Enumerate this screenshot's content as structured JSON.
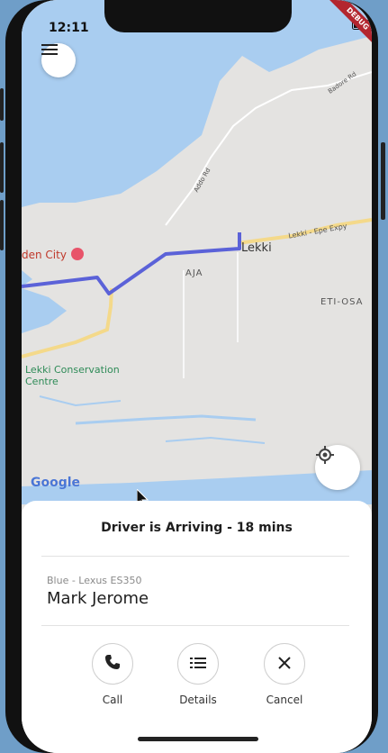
{
  "status_bar": {
    "time": "12:11",
    "debug_label": "DEBUG"
  },
  "map": {
    "labels": {
      "city": "den City",
      "lekki": "Lekki",
      "aja": "AJA",
      "eti_osa": "ETI-OSA",
      "conservation": "Lekki Conservation Centre",
      "expressway": "Lekki - Epe Expy",
      "road_addo": "Addo Rd",
      "road_badore": "Badore Rd"
    },
    "attribution": "Google",
    "route_color": "#5b62d8"
  },
  "controls": {
    "menu_icon": "menu-icon",
    "locate_icon": "my-location-icon"
  },
  "sheet": {
    "title": "Driver is Arriving - 18 mins",
    "car": "Blue - Lexus ES350",
    "driver": "Mark Jerome",
    "actions": [
      {
        "label": "Call",
        "icon": "phone-icon"
      },
      {
        "label": "Details",
        "icon": "list-icon"
      },
      {
        "label": "Cancel",
        "icon": "close-icon"
      }
    ]
  }
}
